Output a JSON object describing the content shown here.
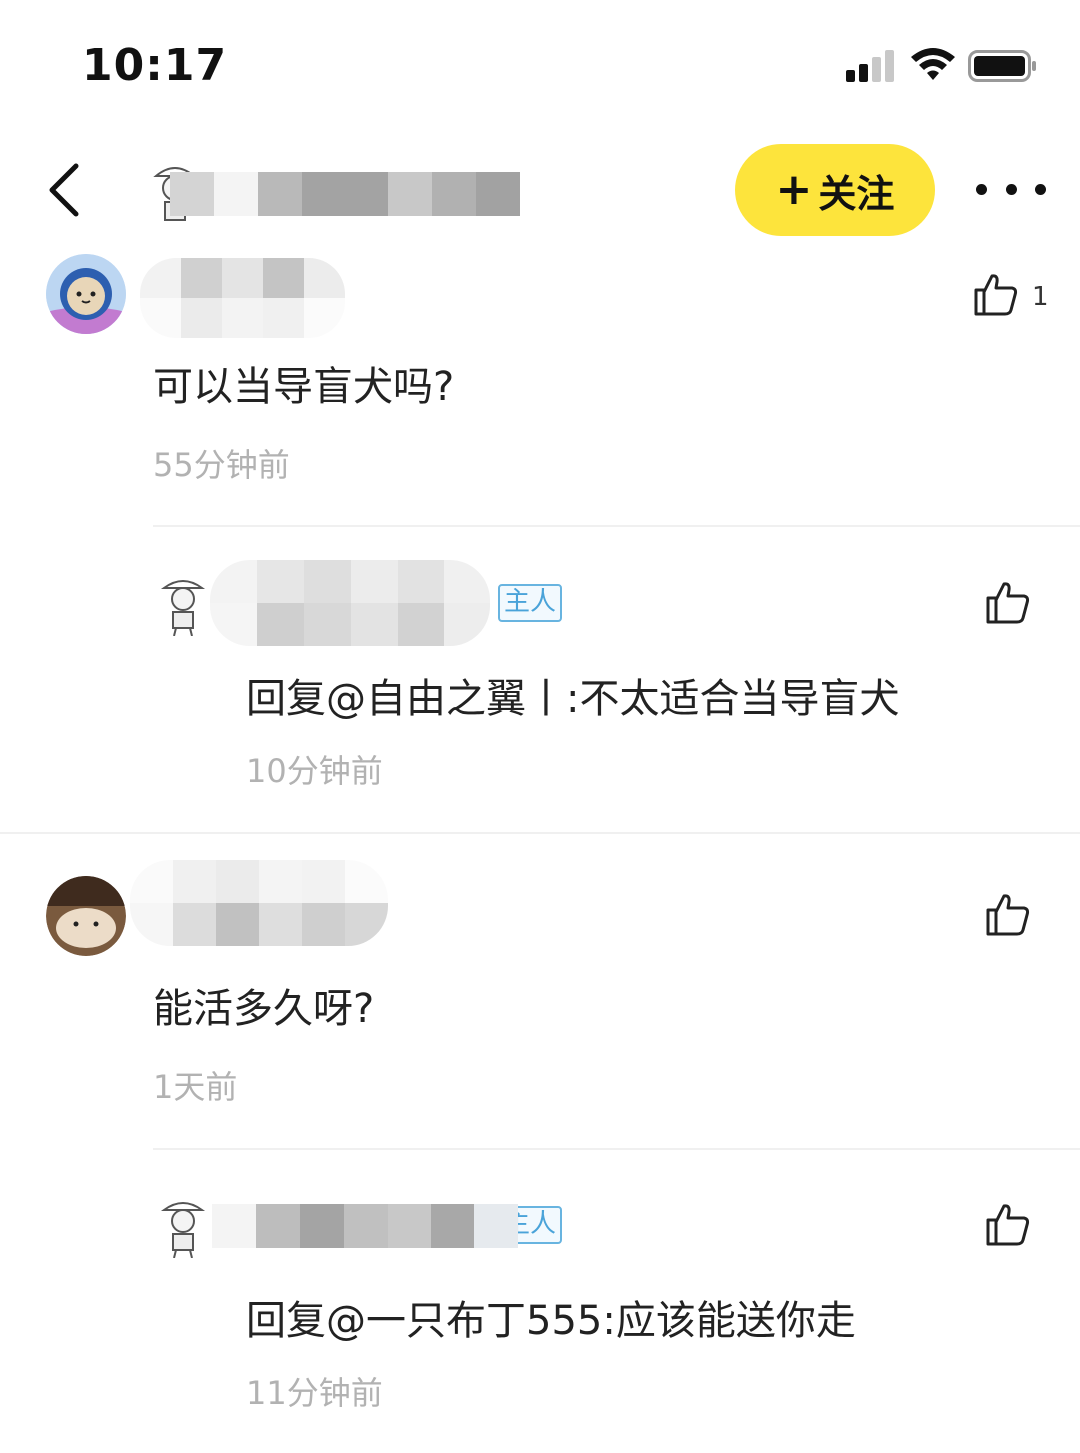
{
  "status": {
    "time": "10:17"
  },
  "header": {
    "follow_plus": "+",
    "follow_label": "关注"
  },
  "comments": [
    {
      "text": "可以当导盲犬吗?",
      "time": "55分钟前",
      "likes": "1",
      "reply": {
        "badge": "主人",
        "text": "回复@自由之翼丨:不太适合当导盲犬",
        "time": "10分钟前"
      }
    },
    {
      "text": "能活多久呀?",
      "time": "1天前",
      "reply": {
        "badge": "主人",
        "text": "回复@一只布丁555:应该能送你走",
        "time": "11分钟前"
      }
    }
  ],
  "colors": {
    "follow_bg": "#fde43c",
    "badge": "#4aa3d9",
    "time_text": "#b2b2b2"
  },
  "icons": [
    "back-arrow-icon",
    "thumbs-up-icon",
    "more-dots-icon",
    "wifi-icon",
    "battery-icon",
    "signal-icon"
  ]
}
